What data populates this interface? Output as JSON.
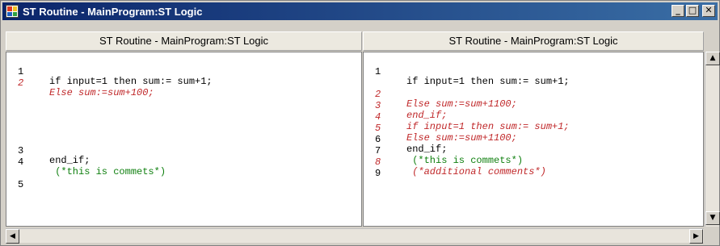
{
  "window": {
    "title": "ST Routine - MainProgram:ST  Logic",
    "buttons": {
      "minimize": "_",
      "maximize": "□",
      "close": "✕"
    }
  },
  "left_pane": {
    "header": "ST Routine - MainProgram:ST  Logic",
    "lines": [
      {
        "num": "1",
        "text": "if input=1 then sum:= sum+1;",
        "style": "normal"
      },
      {
        "num": "2",
        "text": "Else sum:=sum+100;",
        "style": "diff"
      },
      {
        "num": "3",
        "text": "end_if;",
        "style": "normal"
      },
      {
        "num": "4",
        "text": " (*this is commets*)",
        "style": "comment"
      },
      {
        "num": "5",
        "text": "",
        "style": "normal"
      }
    ]
  },
  "right_pane": {
    "header": "ST Routine - MainProgram:ST  Logic",
    "lines": [
      {
        "num": "1",
        "text": "if input=1 then sum:= sum+1;",
        "style": "normal"
      },
      {
        "num": "2",
        "text": "Else sum:=sum+1100;",
        "style": "diff"
      },
      {
        "num": "3",
        "text": "end_if;",
        "style": "diff"
      },
      {
        "num": "4",
        "text": "if input=1 then sum:= sum+1;",
        "style": "diff"
      },
      {
        "num": "5",
        "text": "Else sum:=sum+1100;",
        "style": "diff"
      },
      {
        "num": "6",
        "text": "end_if;",
        "style": "normal"
      },
      {
        "num": "7",
        "text": " (*this is commets*)",
        "style": "comment"
      },
      {
        "num": "8",
        "text": " (*additional comments*)",
        "style": "diff"
      },
      {
        "num": "9",
        "text": "",
        "style": "normal"
      }
    ]
  },
  "scrollbars": {
    "up_icon": "▲",
    "down_icon": "▼",
    "left_icon": "◀",
    "right_icon": "▶"
  },
  "colors": {
    "normal": "#000000",
    "diff": "#c0282a",
    "comment": "#108010",
    "titlebar": "#0a246a"
  }
}
